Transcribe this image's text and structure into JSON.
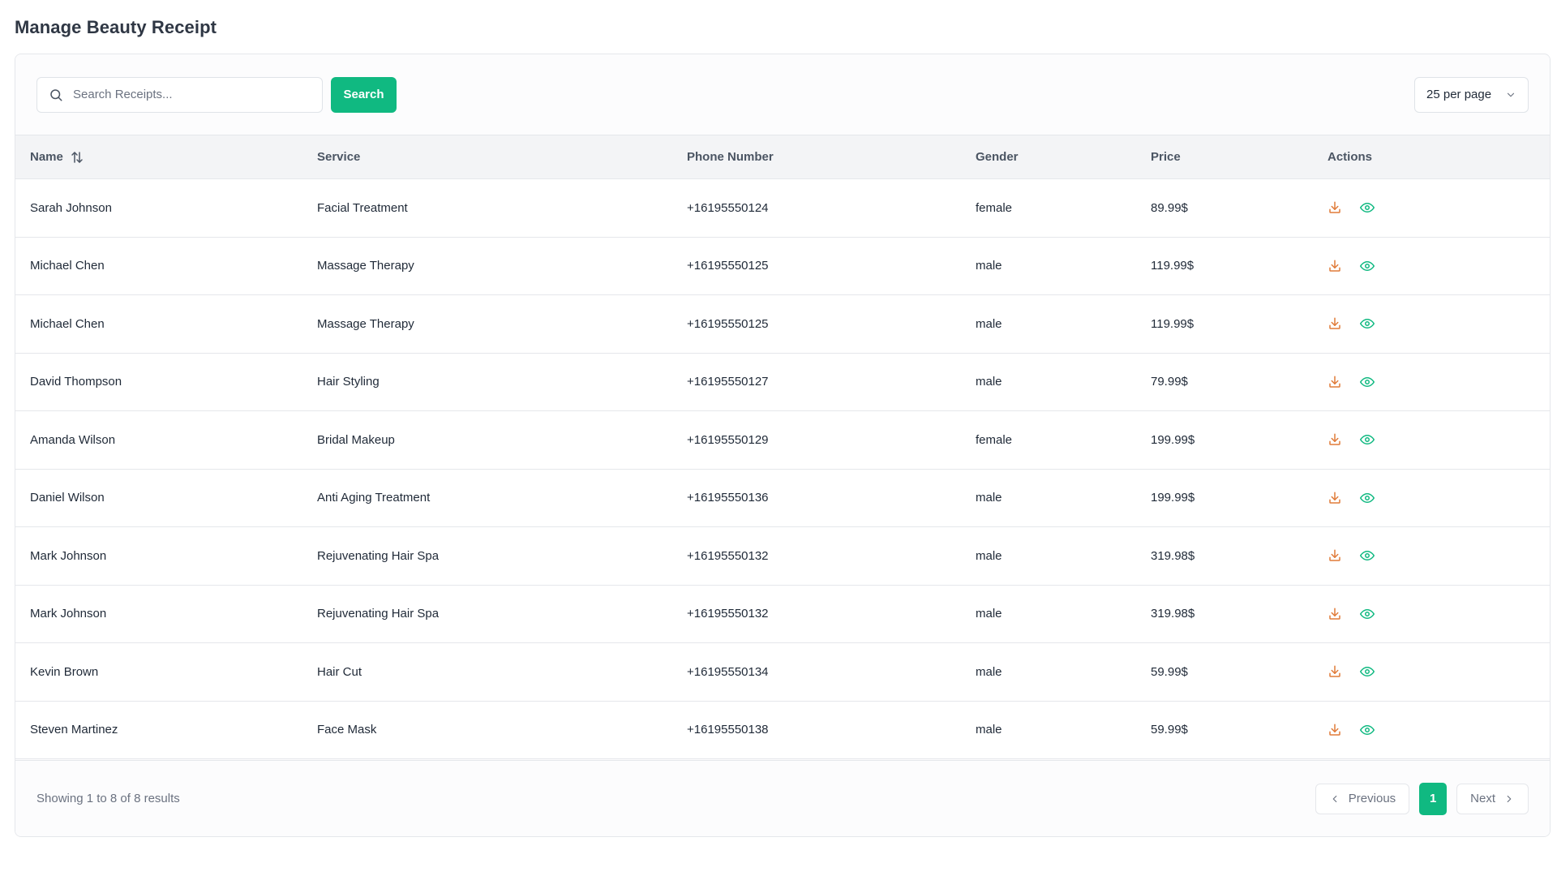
{
  "page": {
    "title": "Manage Beauty Receipt"
  },
  "toolbar": {
    "search_placeholder": "Search Receipts...",
    "search_button": "Search",
    "per_page": "25 per page"
  },
  "table": {
    "headers": {
      "name": "Name",
      "service": "Service",
      "phone": "Phone Number",
      "gender": "Gender",
      "price": "Price",
      "actions": "Actions"
    },
    "rows": [
      {
        "name": "Sarah Johnson",
        "service": "Facial Treatment",
        "phone": "+16195550124",
        "gender": "female",
        "price": "89.99$"
      },
      {
        "name": "Michael Chen",
        "service": "Massage Therapy",
        "phone": "+16195550125",
        "gender": "male",
        "price": "119.99$"
      },
      {
        "name": "Michael Chen",
        "service": "Massage Therapy",
        "phone": "+16195550125",
        "gender": "male",
        "price": "119.99$"
      },
      {
        "name": "David Thompson",
        "service": "Hair Styling",
        "phone": "+16195550127",
        "gender": "male",
        "price": "79.99$"
      },
      {
        "name": "Amanda Wilson",
        "service": "Bridal Makeup",
        "phone": "+16195550129",
        "gender": "female",
        "price": "199.99$"
      },
      {
        "name": "Daniel Wilson",
        "service": "Anti Aging Treatment",
        "phone": "+16195550136",
        "gender": "male",
        "price": "199.99$"
      },
      {
        "name": "Mark Johnson",
        "service": "Rejuvenating Hair Spa",
        "phone": "+16195550132",
        "gender": "male",
        "price": "319.98$"
      },
      {
        "name": "Mark Johnson",
        "service": "Rejuvenating Hair Spa",
        "phone": "+16195550132",
        "gender": "male",
        "price": "319.98$"
      },
      {
        "name": "Kevin Brown",
        "service": "Hair Cut",
        "phone": "+16195550134",
        "gender": "male",
        "price": "59.99$"
      },
      {
        "name": "Steven Martinez",
        "service": "Face Mask",
        "phone": "+16195550138",
        "gender": "male",
        "price": "59.99$"
      }
    ]
  },
  "footer": {
    "showing": "Showing 1 to 8 of 8 results",
    "previous": "Previous",
    "current_page": "1",
    "next": "Next"
  },
  "icons": {
    "search": "search-icon",
    "sort": "sort-arrows-icon",
    "dropdown": "chevron-down-icon",
    "download": "download-icon",
    "view": "eye-icon",
    "prev": "chevron-left-icon",
    "next": "chevron-right-icon"
  },
  "colors": {
    "accent": "#10b981",
    "download_icon": "#e07b39",
    "view_icon": "#10b981"
  }
}
